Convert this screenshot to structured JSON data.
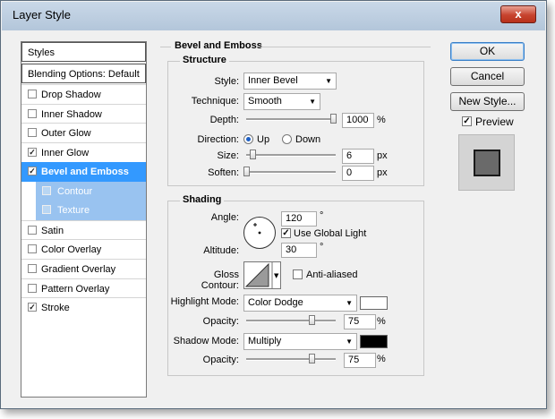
{
  "window": {
    "title": "Layer Style",
    "close_glyph": "x"
  },
  "sidebar": {
    "items": [
      {
        "label": "Styles",
        "checked": null
      },
      {
        "label": "Blending Options: Default",
        "checked": null
      },
      {
        "label": "Drop Shadow",
        "checked": false
      },
      {
        "label": "Inner Shadow",
        "checked": false
      },
      {
        "label": "Outer Glow",
        "checked": false
      },
      {
        "label": "Inner Glow",
        "checked": true
      },
      {
        "label": "Bevel and Emboss",
        "checked": true
      },
      {
        "label": "Contour",
        "checked": false
      },
      {
        "label": "Texture",
        "checked": false
      },
      {
        "label": "Satin",
        "checked": false
      },
      {
        "label": "Color Overlay",
        "checked": false
      },
      {
        "label": "Gradient Overlay",
        "checked": false
      },
      {
        "label": "Pattern Overlay",
        "checked": false
      },
      {
        "label": "Stroke",
        "checked": true
      }
    ]
  },
  "bevel": {
    "group_title": "Bevel and Emboss",
    "structure": {
      "title": "Structure",
      "style_label": "Style:",
      "style_value": "Inner Bevel",
      "technique_label": "Technique:",
      "technique_value": "Smooth",
      "depth_label": "Depth:",
      "depth_value": "1000",
      "depth_unit": "%",
      "direction_label": "Direction:",
      "dir_up": "Up",
      "dir_down": "Down",
      "size_label": "Size:",
      "size_value": "6",
      "size_unit": "px",
      "soften_label": "Soften:",
      "soften_value": "0",
      "soften_unit": "px"
    },
    "shading": {
      "title": "Shading",
      "angle_label": "Angle:",
      "angle_value": "120",
      "angle_unit": "°",
      "global_light_label": "Use Global Light",
      "altitude_label": "Altitude:",
      "altitude_value": "30",
      "altitude_unit": "°",
      "gloss_label": "Gloss Contour:",
      "anti_aliased_label": "Anti-aliased",
      "highlight_mode_label": "Highlight Mode:",
      "highlight_mode_value": "Color Dodge",
      "highlight_opacity_label": "Opacity:",
      "highlight_opacity_value": "75",
      "highlight_opacity_unit": "%",
      "shadow_mode_label": "Shadow Mode:",
      "shadow_mode_value": "Multiply",
      "shadow_opacity_label": "Opacity:",
      "shadow_opacity_value": "75",
      "shadow_opacity_unit": "%",
      "highlight_color": "#ffffff",
      "shadow_color": "#000000"
    }
  },
  "buttons": {
    "ok": "OK",
    "cancel": "Cancel",
    "new_style": "New Style...",
    "preview_label": "Preview"
  },
  "icons": {
    "dropdown": "chevron-down-icon",
    "angle_dial": "angle-dial-icon",
    "checkmark": "check-icon"
  }
}
